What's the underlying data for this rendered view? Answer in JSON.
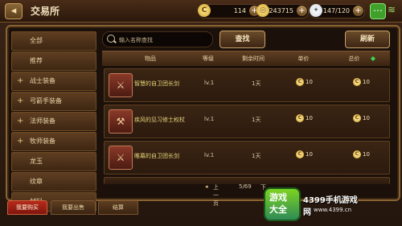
{
  "header": {
    "back_icon": "back-arrow-icon",
    "title": "交易所",
    "resources": [
      {
        "name": "gold",
        "value": "114"
      },
      {
        "name": "coins",
        "value": "243715"
      },
      {
        "name": "stamina",
        "value": "147/120"
      }
    ]
  },
  "sidebar": {
    "items": [
      {
        "label": "全部",
        "plus": ""
      },
      {
        "label": "推荐",
        "plus": ""
      },
      {
        "label": "战士装备",
        "plus": "+"
      },
      {
        "label": "弓箭手装备",
        "plus": "+"
      },
      {
        "label": "法师装备",
        "plus": "+"
      },
      {
        "label": "牧师装备",
        "plus": "+"
      },
      {
        "label": "龙玉",
        "plus": ""
      },
      {
        "label": "纹章",
        "plus": ""
      },
      {
        "label": "材料",
        "plus": ""
      }
    ]
  },
  "search": {
    "placeholder": "输入名称查找",
    "button": "查找"
  },
  "refresh_button": "刷新",
  "table": {
    "headers": {
      "item": "物品",
      "level": "等级",
      "time": "剩余时间",
      "unit": "单价",
      "total": "总价"
    },
    "rows": [
      {
        "name": "智慧的自卫团长剑",
        "level": "lv.1",
        "time": "1天",
        "unit": "10",
        "total": "10"
      },
      {
        "name": "疾风的见习修士权杖",
        "level": "lv.1",
        "time": "1天",
        "unit": "10",
        "total": "10"
      },
      {
        "name": "睢幕的自卫团长剑",
        "level": "lv.1",
        "time": "1天",
        "unit": "10",
        "total": "10"
      }
    ]
  },
  "pager": {
    "prev": "上一页",
    "page": "5/69",
    "next": "下"
  },
  "tabs": [
    {
      "label": "我要购买",
      "active": true
    },
    {
      "label": "我要出售",
      "active": false
    },
    {
      "label": "结算",
      "active": false
    }
  ],
  "watermark": {
    "stamp_line1": "游戏",
    "stamp_line2": "大全",
    "site": "4399手机游戏网",
    "url": "www.4399.cn"
  },
  "colors": {
    "accent_gold": "#e8d67a",
    "active_tab": "#b62c1c",
    "gem_green": "#3fd452"
  }
}
